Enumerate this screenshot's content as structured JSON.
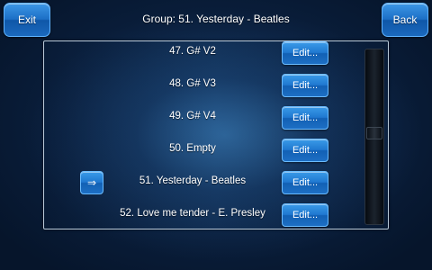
{
  "header": {
    "exit_label": "Exit",
    "back_label": "Back",
    "title": "Group: 51. Yesterday - Beatles"
  },
  "list": {
    "edit_label": "Edit...",
    "current_marker": "⇒",
    "items": [
      {
        "label": "47. G# V2"
      },
      {
        "label": "48. G# V3"
      },
      {
        "label": "49. G# V4"
      },
      {
        "label": "50. Empty"
      },
      {
        "label": "51. Yesterday - Beatles",
        "current": true
      },
      {
        "label": "52. Love me tender - E. Presley"
      }
    ]
  },
  "scrollbar": {
    "position_fraction": 0.48
  }
}
